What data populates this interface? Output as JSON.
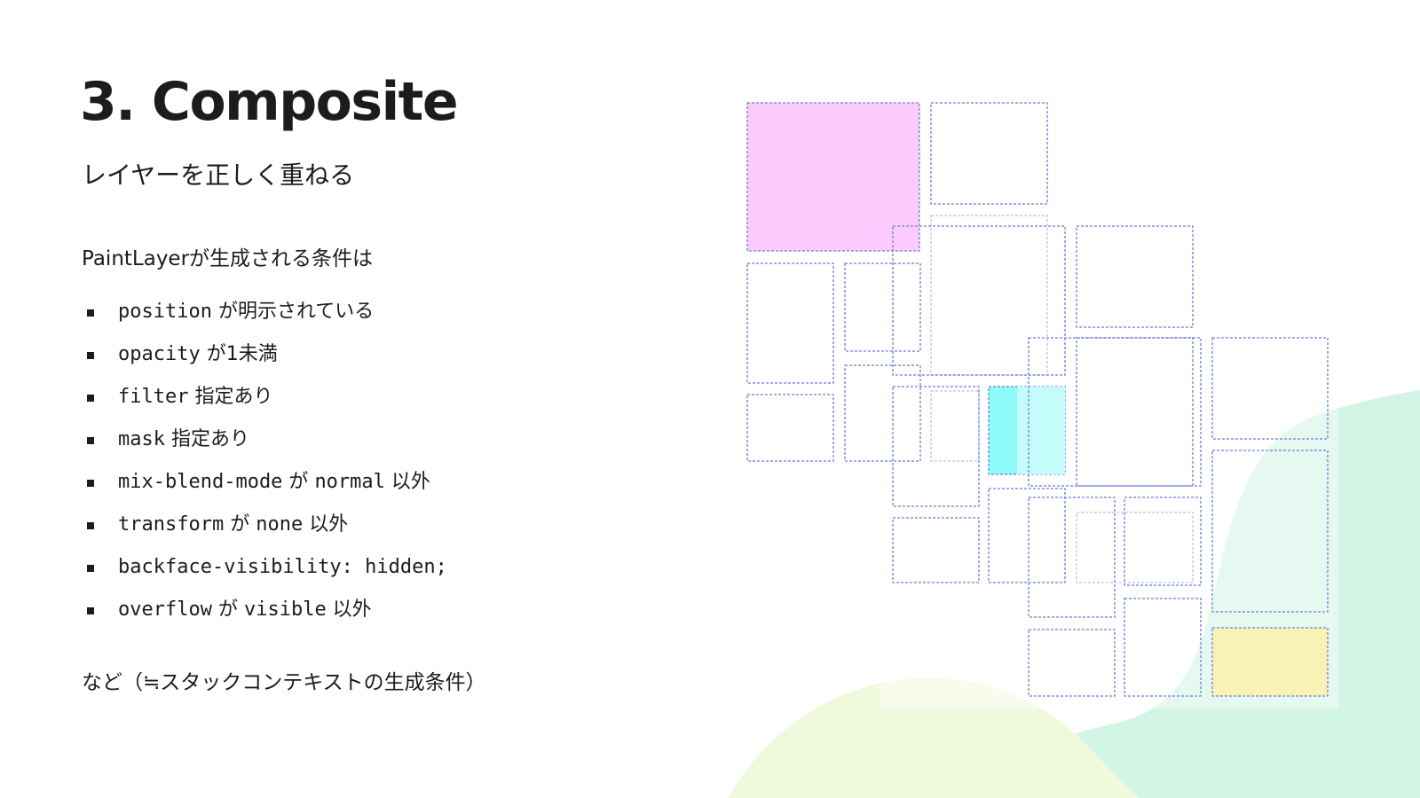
{
  "slide": {
    "title": "3. Composite",
    "subtitle": "レイヤーを正しく重ねる",
    "intro": "PaintLayerが生成される条件は",
    "conditions": [
      {
        "code": "position",
        "text": " が明示されている",
        "code2": "",
        "text2": ""
      },
      {
        "code": "opacity",
        "text": " が1未満",
        "code2": "",
        "text2": ""
      },
      {
        "code": "filter",
        "text": " 指定あり",
        "code2": "",
        "text2": ""
      },
      {
        "code": "mask",
        "text": " 指定あり",
        "code2": "",
        "text2": ""
      },
      {
        "code": "mix-blend-mode",
        "text": " が ",
        "code2": "normal",
        "text2": " 以外"
      },
      {
        "code": "transform",
        "text": " が ",
        "code2": "none",
        "text2": " 以外"
      },
      {
        "code": "backface-visibility: hidden;",
        "text": "",
        "code2": "",
        "text2": ""
      },
      {
        "code": "overflow",
        "text": " が ",
        "code2": "visible",
        "text2": " 以外"
      }
    ],
    "footer_note": "など（≒スタックコンテキストの生成条件）"
  },
  "colors": {
    "text": "#1c1c1c",
    "box_border": "#6b7fd6",
    "box_border_faint": "#b9c2ec",
    "magenta_fill": "#fecbfe",
    "cyan_fill": "#8ffcfc",
    "cyan_light_fill": "#c4fbfb",
    "yellow_fill": "#f8f2b5",
    "blob_green": "#d2f5e6",
    "blob_lime": "#f1f9dc"
  }
}
